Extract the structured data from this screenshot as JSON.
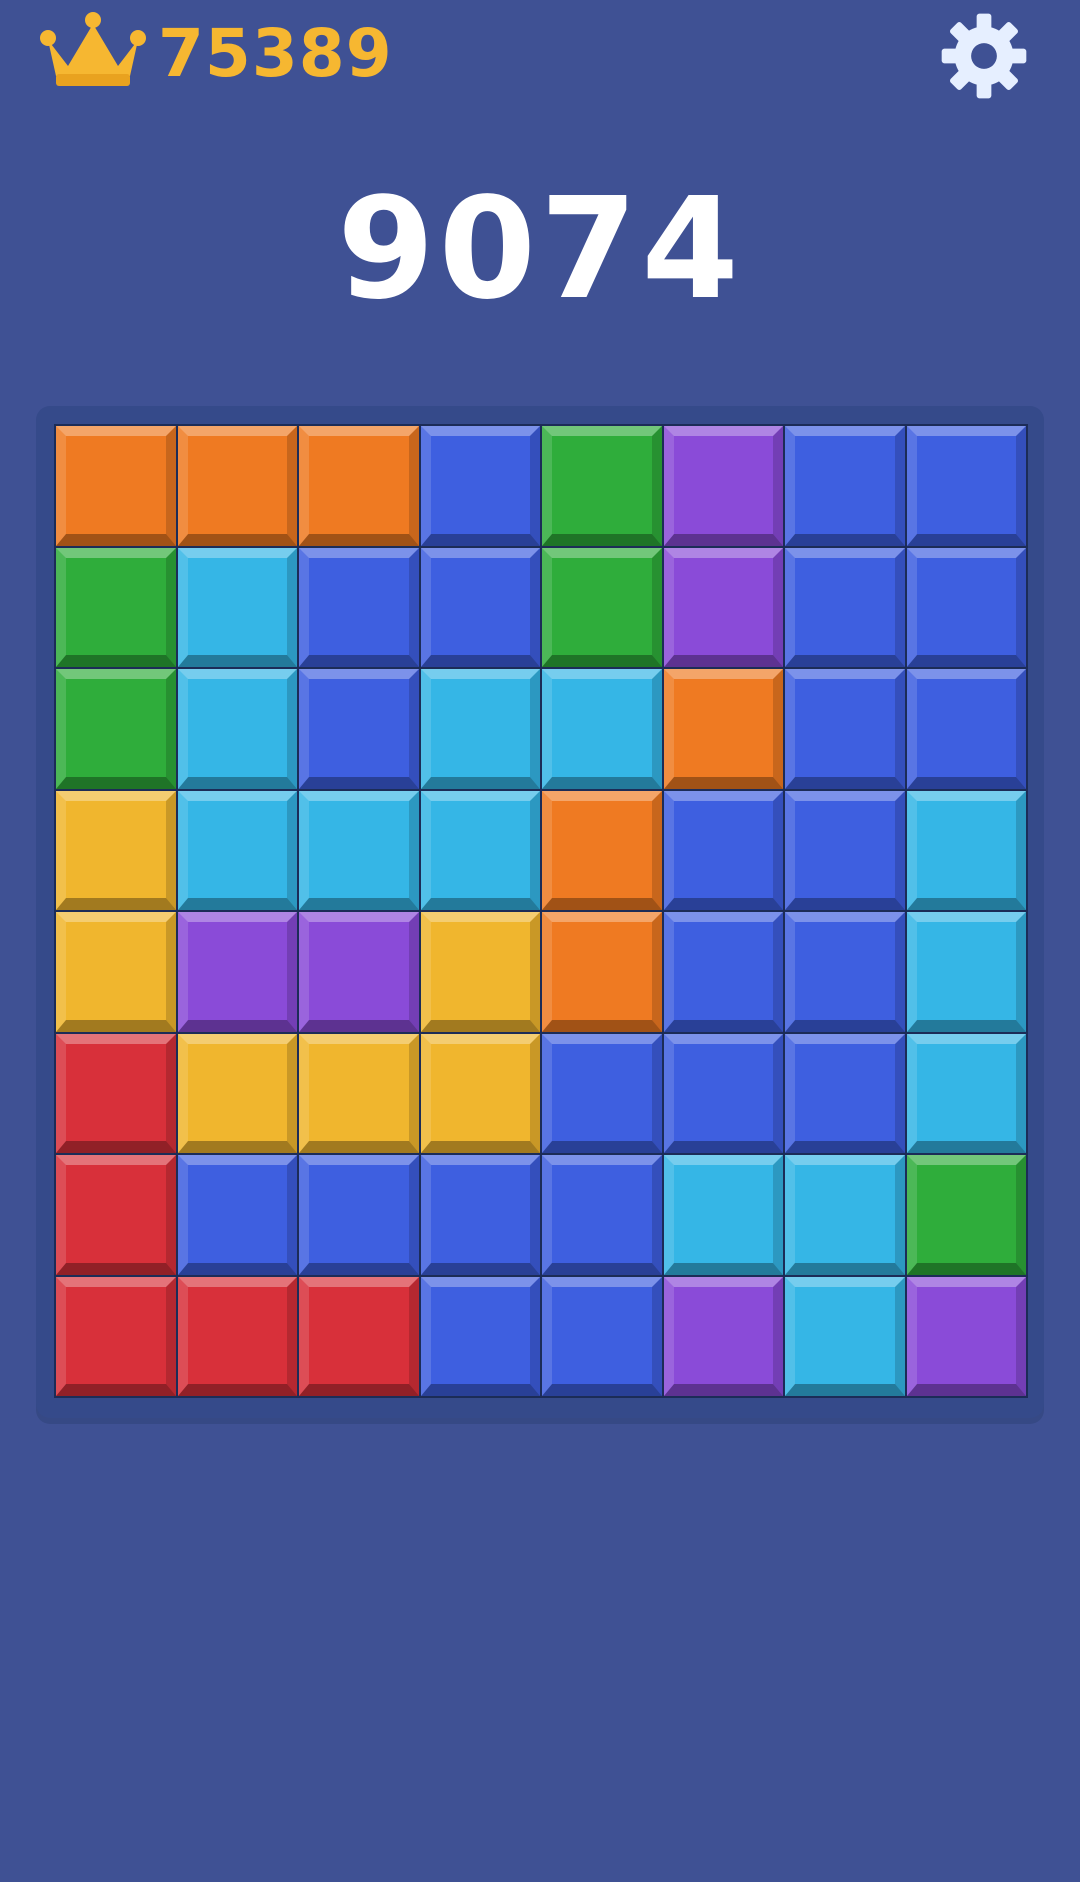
{
  "hud": {
    "best_score": "75389",
    "current_score": "9074",
    "crown_icon": "crown-icon",
    "settings_icon": "gear-icon"
  },
  "colors": {
    "background": "#3f5194",
    "best_score": "#f6b731",
    "orange": "#ef7a22",
    "blue": "#3e5fe0",
    "green": "#2fad3b",
    "purple": "#8a4bd8",
    "cyan": "#35b6e6",
    "yellow": "#f0b62e",
    "red": "#d8303a"
  },
  "board": {
    "rows": 8,
    "cols": 8,
    "cells": [
      [
        "orange",
        "orange",
        "orange",
        "blue",
        "green",
        "purple",
        "blue",
        "blue"
      ],
      [
        "green",
        "cyan",
        "blue",
        "blue",
        "green",
        "purple",
        "blue",
        "blue"
      ],
      [
        "green",
        "cyan",
        "blue",
        "cyan",
        "cyan",
        "orange",
        "blue",
        "blue"
      ],
      [
        "yellow",
        "cyan",
        "cyan",
        "cyan",
        "orange",
        "blue",
        "blue",
        "cyan"
      ],
      [
        "yellow",
        "purple",
        "purple",
        "yellow",
        "orange",
        "blue",
        "blue",
        "cyan"
      ],
      [
        "red",
        "yellow",
        "yellow",
        "yellow",
        "blue",
        "blue",
        "blue",
        "cyan"
      ],
      [
        "red",
        "blue",
        "blue",
        "blue",
        "blue",
        "cyan",
        "cyan",
        "green"
      ],
      [
        "red",
        "red",
        "red",
        "blue",
        "blue",
        "purple",
        "cyan",
        "purple"
      ]
    ]
  }
}
